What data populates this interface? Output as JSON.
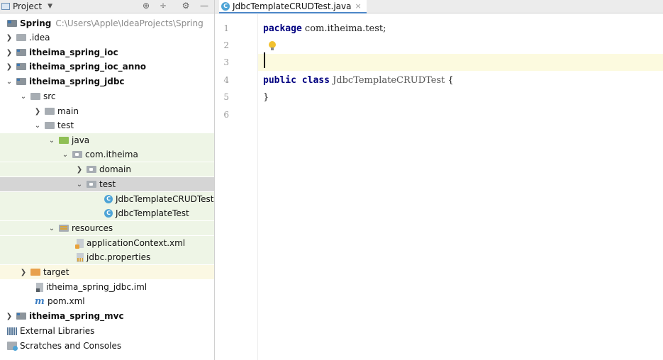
{
  "project_panel": {
    "title": "Project",
    "tools": [
      "⊕",
      "÷",
      "⚙",
      "—"
    ],
    "root": {
      "name": "Spring",
      "path": "C:\\Users\\Apple\\IdeaProjects\\Spring"
    },
    "items": [
      {
        "label": ".idea"
      },
      {
        "label": "itheima_spring_ioc"
      },
      {
        "label": "itheima_spring_ioc_anno"
      },
      {
        "label": "itheima_spring_jdbc"
      },
      {
        "label": "src"
      },
      {
        "label": "main"
      },
      {
        "label": "test"
      },
      {
        "label": "java"
      },
      {
        "label": "com.itheima"
      },
      {
        "label": "domain"
      },
      {
        "label": "test"
      },
      {
        "label": "JdbcTemplateCRUDTest"
      },
      {
        "label": "JdbcTemplateTest"
      },
      {
        "label": "resources"
      },
      {
        "label": "applicationContext.xml"
      },
      {
        "label": "jdbc.properties"
      },
      {
        "label": "target"
      },
      {
        "label": "itheima_spring_jdbc.iml"
      },
      {
        "label": "pom.xml"
      },
      {
        "label": "itheima_spring_mvc"
      },
      {
        "label": "External Libraries"
      },
      {
        "label": "Scratches and Consoles"
      }
    ]
  },
  "editor": {
    "tab": {
      "label": "JdbcTemplateCRUDTest.java",
      "icon": "C",
      "close": "×"
    },
    "line_numbers": [
      "1",
      "2",
      "3",
      "4",
      "5",
      "6"
    ],
    "code": {
      "kw_package": "package",
      "package_name": " com.itheima.test;",
      "kw_public": "public",
      "kw_class": " class",
      "class_name": " JdbcTemplateCRUDTest",
      "open_brace": " {",
      "close_brace": "}"
    }
  },
  "colors": {
    "selection": "#d5d5d5",
    "test_root_highlight": "#eef5e6",
    "excluded_highlight": "#fbf8e3",
    "current_line": "#fcfadf",
    "keyword": "#000080"
  }
}
